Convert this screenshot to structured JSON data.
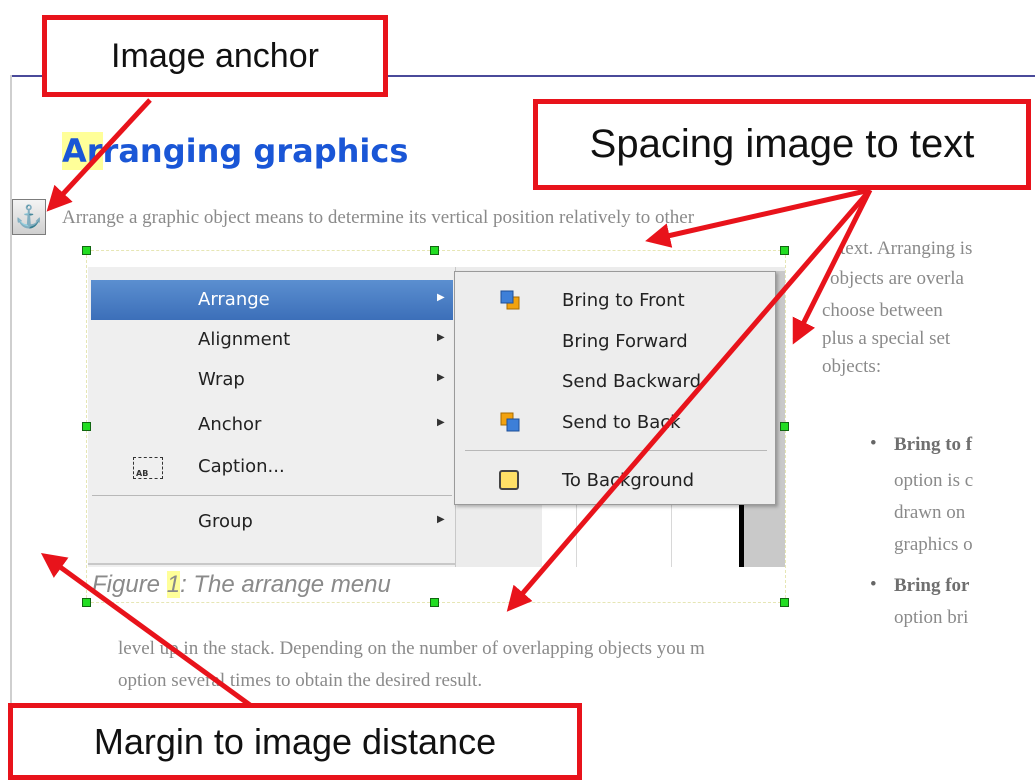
{
  "heading": {
    "text": "Arranging graphics"
  },
  "body": {
    "line1": "Arrange a graphic object means to determine its vertical position relatively to other",
    "right_lines": [
      "text. Arranging is",
      "objects are overla",
      "choose between",
      "plus a special set",
      "objects:"
    ],
    "bullet1": {
      "bold": "Bring to f",
      "lines": [
        "option is c",
        "drawn on",
        "graphics o"
      ]
    },
    "bullet2": {
      "bold": "Bring for",
      "lines": [
        "option bri"
      ]
    },
    "bottom_line1": "level up in the stack. Depending on the number of overlapping objects you m",
    "bottom_line2": "option several times to obtain the desired result."
  },
  "context_menu": {
    "items": [
      {
        "label": "Arrange",
        "has_submenu": true,
        "selected": true
      },
      {
        "label": "Alignment",
        "has_submenu": true
      },
      {
        "label": "Wrap",
        "has_submenu": true
      },
      {
        "label": "Anchor",
        "has_submenu": true
      },
      {
        "label": "Caption...",
        "icon": "caption-icon",
        "icon_text": "AB"
      },
      {
        "label": "Group",
        "has_submenu": true
      }
    ]
  },
  "submenu": {
    "items": [
      {
        "label": "Bring to Front",
        "icon": "bring-to-front-icon"
      },
      {
        "label": "Bring Forward"
      },
      {
        "label": "Send Backward"
      },
      {
        "label": "Send to Back",
        "icon": "send-to-back-icon"
      },
      {
        "label": "To Background",
        "icon": "to-background-icon"
      }
    ]
  },
  "figure": {
    "prefix": "Figure ",
    "number": "1",
    "suffix": ": The arrange menu"
  },
  "callouts": {
    "image_anchor": "Image anchor",
    "spacing": "Spacing image to text",
    "margin": "Margin to image distance"
  },
  "icons": {
    "anchor": "anchor-icon"
  },
  "colors": {
    "callout_border": "#e8131b",
    "arrow": "#e8131b",
    "heading": "#1a56d6",
    "menu_selected": "#4a7fc6",
    "handle": "#22dd22"
  }
}
